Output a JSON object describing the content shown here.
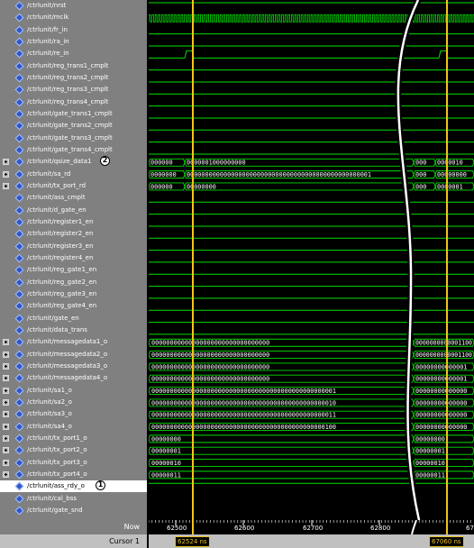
{
  "signals": [
    {
      "name": "/ctrlunit/nrst",
      "expand": false,
      "wave": "high"
    },
    {
      "name": "/ctrlunit/mclk",
      "expand": false,
      "wave": "clock"
    },
    {
      "name": "/ctrlunit/fr_in",
      "expand": false,
      "wave": "low"
    },
    {
      "name": "/ctrlunit/ra_in",
      "expand": false,
      "wave": "low"
    },
    {
      "name": "/ctrlunit/re_in",
      "expand": false,
      "wave": "pulse"
    },
    {
      "name": "/ctrlunit/reg_trans1_cmplt",
      "expand": false,
      "wave": "low"
    },
    {
      "name": "/ctrlunit/reg_trans2_cmplt",
      "expand": false,
      "wave": "low"
    },
    {
      "name": "/ctrlunit/reg_trans3_cmplt",
      "expand": false,
      "wave": "low"
    },
    {
      "name": "/ctrlunit/reg_trans4_cmplt",
      "expand": false,
      "wave": "low"
    },
    {
      "name": "/ctrlunit/gate_trans1_cmplt",
      "expand": false,
      "wave": "low"
    },
    {
      "name": "/ctrlunit/gate_trans2_cmplt",
      "expand": false,
      "wave": "low"
    },
    {
      "name": "/ctrlunit/gate_trans3_cmplt",
      "expand": false,
      "wave": "low"
    },
    {
      "name": "/ctrlunit/gate_trans4_cmplt",
      "expand": false,
      "wave": "low"
    },
    {
      "name": "/ctrlunit/qsize_data1",
      "expand": true,
      "wave": "bus",
      "marker": "2",
      "v1": "000000",
      "v2": "0000001000000000",
      "v3": "000",
      "v4": "0000010"
    },
    {
      "name": "/ctrlunit/sa_rd",
      "expand": true,
      "wave": "bus",
      "v1": "0000000",
      "v2": "00000000000000000000000000000000000000000000000001",
      "v3": "000",
      "v4": "00000000"
    },
    {
      "name": "/ctrlunit/tx_port_rd",
      "expand": true,
      "wave": "bus",
      "v1": "000000",
      "v2": "00000000",
      "v3": "000",
      "v4": "0000001"
    },
    {
      "name": "/ctrlunit/ass_cmplt",
      "expand": false,
      "wave": "low"
    },
    {
      "name": "/ctrlunit/d_gate_en",
      "expand": false,
      "wave": "low"
    },
    {
      "name": "/ctrlunit/register1_en",
      "expand": false,
      "wave": "low"
    },
    {
      "name": "/ctrlunit/register2_en",
      "expand": false,
      "wave": "low"
    },
    {
      "name": "/ctrlunit/register3_en",
      "expand": false,
      "wave": "low"
    },
    {
      "name": "/ctrlunit/register4_en",
      "expand": false,
      "wave": "low"
    },
    {
      "name": "/ctrlunit/reg_gate1_en",
      "expand": false,
      "wave": "low"
    },
    {
      "name": "/ctrlunit/reg_gate2_en",
      "expand": false,
      "wave": "low"
    },
    {
      "name": "/ctrlunit/reg_gate3_en",
      "expand": false,
      "wave": "low"
    },
    {
      "name": "/ctrlunit/reg_gate4_en",
      "expand": false,
      "wave": "low"
    },
    {
      "name": "/ctrlunit/gate_en",
      "expand": false,
      "wave": "low"
    },
    {
      "name": "/ctrlunit/data_trans",
      "expand": false,
      "wave": "low"
    },
    {
      "name": "/ctrlunit/messagedata1_o",
      "expand": true,
      "wave": "bus2",
      "v1": "00000000000000000000000000000000",
      "v2": "0000000000001100"
    },
    {
      "name": "/ctrlunit/messagedata2_o",
      "expand": true,
      "wave": "bus2",
      "v1": "00000000000000000000000000000000",
      "v2": "0000000000001100"
    },
    {
      "name": "/ctrlunit/messagedata3_o",
      "expand": true,
      "wave": "bus2",
      "v1": "00000000000000000000000000000000",
      "v2": "00000000000001"
    },
    {
      "name": "/ctrlunit/messagedata4_o",
      "expand": true,
      "wave": "bus2",
      "v1": "00000000000000000000000000000000",
      "v2": "00000000000001"
    },
    {
      "name": "/ctrlunit/sa1_o",
      "expand": true,
      "wave": "bus2",
      "v1": "00000000000000000000000000000000000000000000000001",
      "v2": "00000000000000"
    },
    {
      "name": "/ctrlunit/sa2_o",
      "expand": true,
      "wave": "bus2",
      "v1": "00000000000000000000000000000000000000000000000010",
      "v2": "00000000000000"
    },
    {
      "name": "/ctrlunit/sa3_o",
      "expand": true,
      "wave": "bus2",
      "v1": "00000000000000000000000000000000000000000000000011",
      "v2": "00000000000000"
    },
    {
      "name": "/ctrlunit/sa4_o",
      "expand": true,
      "wave": "bus2",
      "v1": "00000000000000000000000000000000000000000000000100",
      "v2": "00000000000000"
    },
    {
      "name": "/ctrlunit/tx_port1_o",
      "expand": true,
      "wave": "bus2",
      "v1": "00000000",
      "v2": "00000000"
    },
    {
      "name": "/ctrlunit/tx_port2_o",
      "expand": true,
      "wave": "bus2",
      "v1": "00000001",
      "v2": "00000001"
    },
    {
      "name": "/ctrlunit/tx_port3_o",
      "expand": true,
      "wave": "bus2",
      "v1": "00000010",
      "v2": "00000010"
    },
    {
      "name": "/ctrlunit/tx_port4_o",
      "expand": true,
      "wave": "bus2",
      "v1": "00000011",
      "v2": "00000011"
    },
    {
      "name": "/ctrlunit/ass_rdy_o",
      "expand": false,
      "wave": "high",
      "selected": true,
      "marker": "1"
    },
    {
      "name": "/ctrlunit/cal_bss",
      "expand": false,
      "wave": "none"
    },
    {
      "name": "/ctrlunit/gate_snd",
      "expand": false,
      "wave": "none"
    }
  ],
  "timeline": {
    "now_label": "Now",
    "cursor_label": "Cursor 1",
    "ticks": [
      "62500",
      "62600",
      "62700",
      "62800",
      "67"
    ],
    "cursor1_time": "62524 ns",
    "cursor2_time": "67060 ns"
  },
  "colors": {
    "wave": "#00e000",
    "cursor": "#f0c419",
    "name_panel": "#808080",
    "signal_icon": "#2f57c9",
    "break_curve": "#ffffff"
  }
}
